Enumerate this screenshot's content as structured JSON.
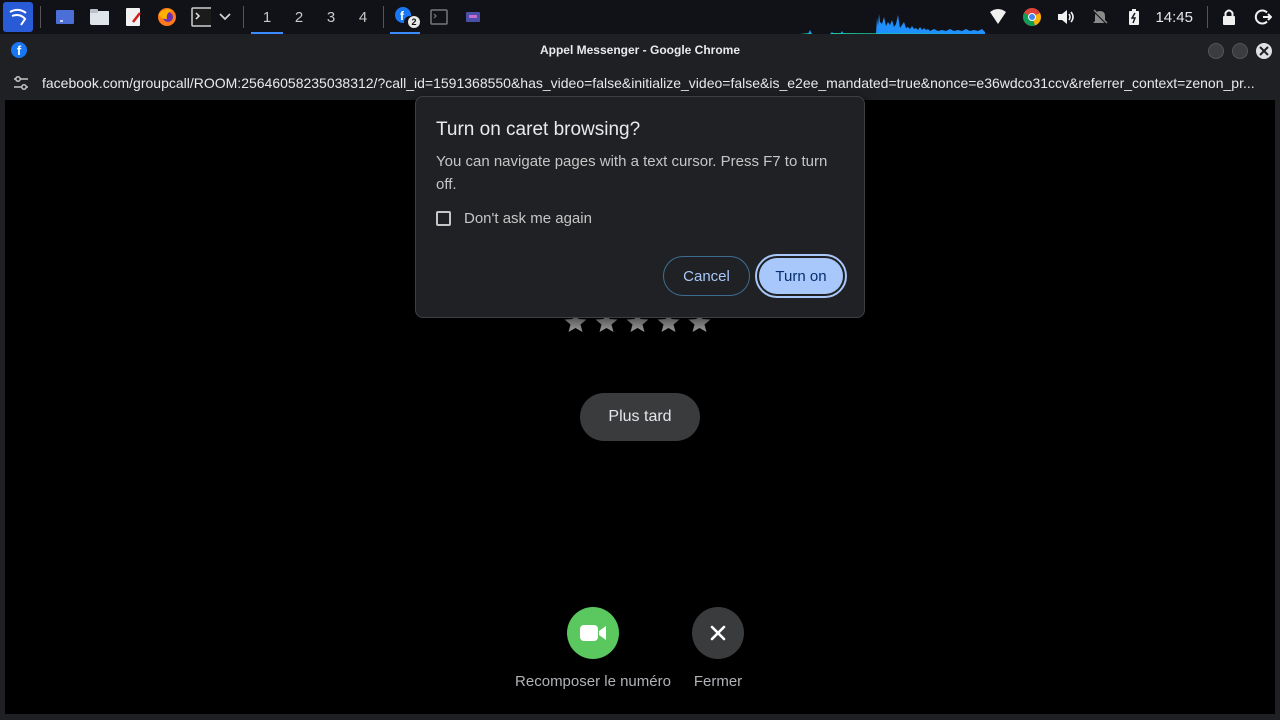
{
  "taskbar": {
    "workspaces": [
      "1",
      "2",
      "3",
      "4"
    ],
    "active_workspace": "1",
    "messenger_badge": "2",
    "clock": "14:45",
    "launchers": [
      "kali-menu-icon",
      "desktop-icon",
      "file-manager-icon",
      "text-editor-icon",
      "firefox-icon",
      "terminal-icon",
      "chevron-down-icon"
    ],
    "tray_icons": [
      "wifi-icon",
      "chrome-icon",
      "volume-icon",
      "notifications-muted-icon",
      "battery-icon",
      "lock-icon",
      "logout-icon"
    ]
  },
  "window": {
    "title": "Appel Messenger - Google Chrome",
    "url": "facebook.com/groupcall/ROOM:25646058235038312/?call_id=1591368550&has_video=false&initialize_video=false&is_e2ee_mandated=true&nonce=e36wdco31ccv&referrer_context=zenon_pr..."
  },
  "page": {
    "rating_stars": 5,
    "later_button": "Plus tard",
    "recall_label": "Recomposer le numéro",
    "close_label": "Fermer"
  },
  "dialog": {
    "title": "Turn on caret browsing?",
    "body": "You can navigate pages with a text cursor. Press F7 to turn off.",
    "checkbox_label": "Don't ask me again",
    "checkbox_checked": false,
    "cancel_label": "Cancel",
    "confirm_label": "Turn on"
  },
  "colors": {
    "accent": "#a8c7fa",
    "recall_green": "#5ac75f",
    "facebook_blue": "#1877f2",
    "taskbar_active": "#3b8bff"
  }
}
